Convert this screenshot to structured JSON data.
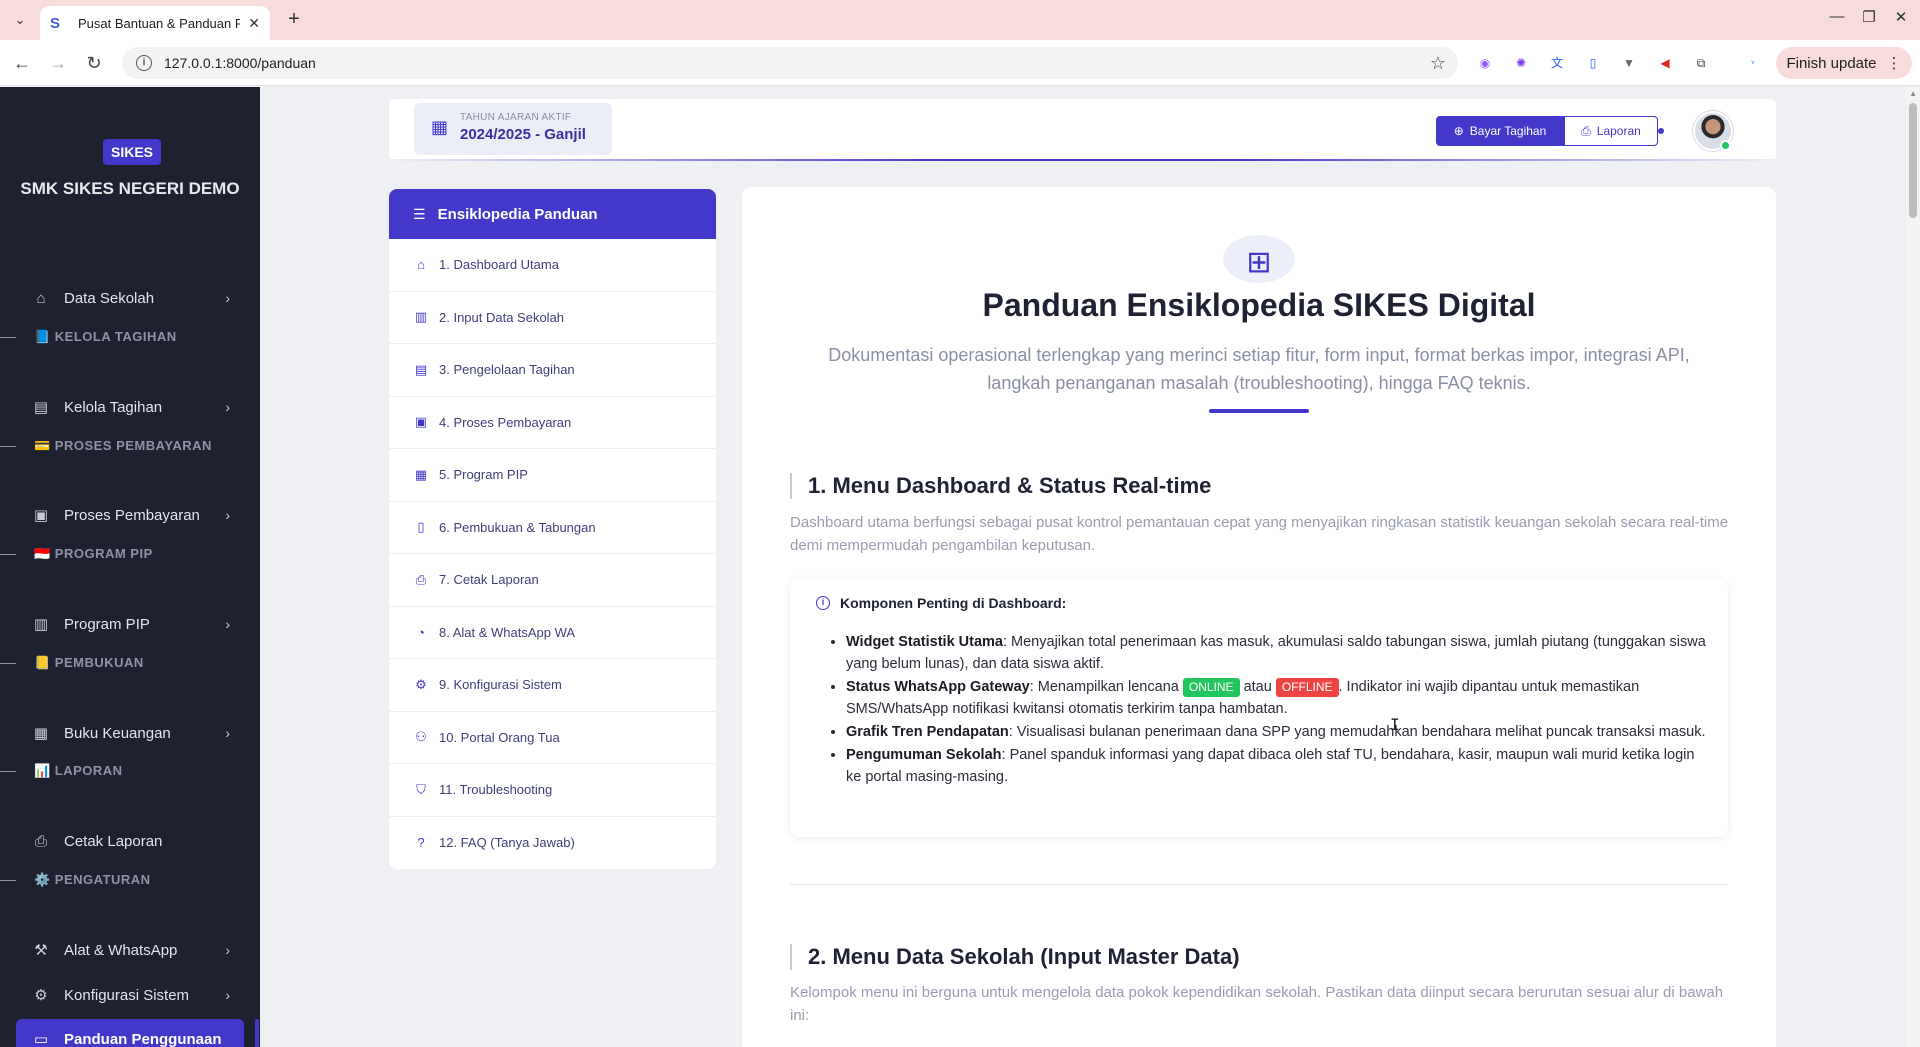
{
  "browser": {
    "tab_title": "Pusat Bantuan & Panduan Pe",
    "url": "127.0.0.1:8000/panduan",
    "finish_update": "Finish update"
  },
  "sidebar": {
    "logo_badge": "SIKES",
    "school_name": "SMK SIKES NEGERI DEMO",
    "sections": [
      {
        "label": "📘 KELOLA TAGIHAN"
      },
      {
        "label": "💳 PROSES PEMBAYARAN"
      },
      {
        "label": "🇮🇩 PROGRAM PIP"
      },
      {
        "label": "📒 PEMBUKUAN"
      },
      {
        "label": "📊 LAPORAN"
      },
      {
        "label": "⚙️ PENGATURAN"
      }
    ],
    "items": [
      {
        "label": "Data Sekolah",
        "icon": "building-icon"
      },
      {
        "label": "Kelola Tagihan",
        "icon": "invoice-icon"
      },
      {
        "label": "Proses Pembayaran",
        "icon": "cash-icon"
      },
      {
        "label": "Program PIP",
        "icon": "id-card-icon"
      },
      {
        "label": "Buku Keuangan",
        "icon": "book-icon"
      },
      {
        "label": "Cetak Laporan",
        "icon": "printer-icon"
      },
      {
        "label": "Alat & WhatsApp",
        "icon": "tools-icon"
      },
      {
        "label": "Konfigurasi Sistem",
        "icon": "gear-icon"
      },
      {
        "label": "Panduan Penggunaan",
        "icon": "book-open-icon"
      }
    ]
  },
  "header": {
    "tahun_label": "TAHUN AJARAN AKTIF",
    "tahun_value": "2024/2025 - Ganjil",
    "btn_bayar": "Bayar Tagihan",
    "btn_laporan": "Laporan"
  },
  "toc": {
    "title": "Ensiklopedia Panduan",
    "items": [
      {
        "label": "1. Dashboard Utama",
        "icon": "home-icon"
      },
      {
        "label": "2. Input Data Sekolah",
        "icon": "building-icon"
      },
      {
        "label": "3. Pengelolaan Tagihan",
        "icon": "invoice-icon"
      },
      {
        "label": "4. Proses Pembayaran",
        "icon": "cash-icon"
      },
      {
        "label": "5. Program PIP",
        "icon": "id-card-icon"
      },
      {
        "label": "6. Pembukuan & Tabungan",
        "icon": "book-icon"
      },
      {
        "label": "7. Cetak Laporan",
        "icon": "printer-icon"
      },
      {
        "label": "8. Alat & WhatsApp WA",
        "icon": "whatsapp-icon"
      },
      {
        "label": "9. Konfigurasi Sistem",
        "icon": "gear-icon"
      },
      {
        "label": "10. Portal Orang Tua",
        "icon": "users-icon"
      },
      {
        "label": "11. Troubleshooting",
        "icon": "shield-icon"
      },
      {
        "label": "12. FAQ (Tanya Jawab)",
        "icon": "question-icon"
      }
    ]
  },
  "main": {
    "title": "Panduan Ensiklopedia SIKES Digital",
    "subtitle": "Dokumentasi operasional terlengkap yang merinci setiap fitur, form input, format berkas impor, integrasi API, langkah penanganan masalah (troubleshooting), hingga FAQ teknis.",
    "section1": {
      "title": "1. Menu Dashboard & Status Real-time",
      "desc": "Dashboard utama berfungsi sebagai pusat kontrol pemantauan cepat yang menyajikan ringkasan statistik keuangan sekolah secara real-time demi mempermudah pengambilan keputusan.",
      "callout_title": "Komponen Penting di Dashboard:",
      "items": [
        {
          "term": "Widget Statistik Utama",
          "text": ": Menyajikan total penerimaan kas masuk, akumulasi saldo tabungan siswa, jumlah piutang (tunggakan siswa yang belum lunas), dan data siswa aktif."
        },
        {
          "term": "Status WhatsApp Gateway",
          "text_a": ": Menampilkan lencana ",
          "online": "ONLINE",
          "mid": " atau ",
          "offline": "OFFLINE",
          "text_b": ". Indikator ini wajib dipantau untuk memastikan SMS/WhatsApp notifikasi kwitansi otomatis terkirim tanpa hambatan."
        },
        {
          "term": "Grafik Tren Pendapatan",
          "text": ": Visualisasi bulanan penerimaan dana SPP yang memudahkan bendahara melihat puncak transaksi masuk."
        },
        {
          "term": "Pengumuman Sekolah",
          "text": ": Panel spanduk informasi yang dapat dibaca oleh staf TU, bendahara, kasir, maupun wali murid ketika login ke portal masing-masing."
        }
      ]
    },
    "section2": {
      "title": "2. Menu Data Sekolah (Input Master Data)",
      "desc": "Kelompok menu ini berguna untuk mengelola data pokok kependidikan sekolah. Pastikan data diinput secara berurutan sesuai alur di bawah ini:"
    }
  }
}
